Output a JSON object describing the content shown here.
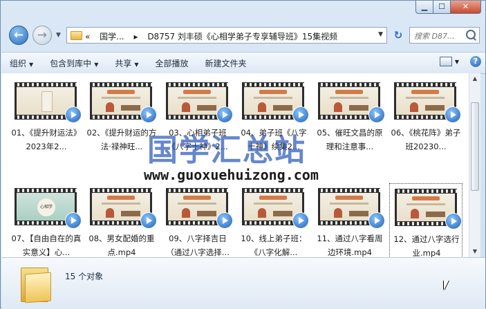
{
  "window": {
    "caption_min": "▁",
    "caption_max": "☐",
    "caption_close": "✕"
  },
  "nav": {
    "back_glyph": "←",
    "forward_glyph": "→",
    "dropdown_glyph": "▼"
  },
  "address": {
    "overflow": "«",
    "crumbs": [
      "国学...",
      "▸",
      "D8757 刘丰硕《心相学弟子专享辅导班》15集视频"
    ],
    "dropdown_glyph": "▼",
    "refresh_glyph": "↻"
  },
  "search": {
    "placeholder": "搜索 D87..."
  },
  "toolbar": {
    "items": [
      "组织",
      "包含到库中",
      "共享",
      "全部播放",
      "新建文件夹"
    ],
    "dropdown_glyph": "▼",
    "help_glyph": "?"
  },
  "files": [
    {
      "label": "01、《提升财运法》2023年2..."
    },
    {
      "label": "02、《提升财运的方法·禄神旺..."
    },
    {
      "label": "03、心相弟子班《八字十神》2..."
    },
    {
      "label": "04、弟子班《八字十神》续集2..."
    },
    {
      "label": "05、催旺文昌的原理和注意事..."
    },
    {
      "label": "06、《桃花阵》弟子班20230..."
    },
    {
      "label": "07、【自由自在的真实意义】心..."
    },
    {
      "label": "08、男女配婚的重点.mp4"
    },
    {
      "label": "09、八字择吉日（通过八字选择..."
    },
    {
      "label": "10、线上弟子班：《八字化解..."
    },
    {
      "label": "11、通过八字看周边环境.mp4"
    },
    {
      "label": "12、通过八字选行业.mp4"
    }
  ],
  "thumb_text": {
    "banner": "心相学弟子班",
    "seal": "心相学"
  },
  "watermark": {
    "title": "国学汇总站",
    "url": "www.guoxuehuizong.com"
  },
  "details": {
    "count": "15 个对象"
  },
  "scrollbar": {
    "up_glyph": "▲",
    "down_glyph": "▼"
  }
}
